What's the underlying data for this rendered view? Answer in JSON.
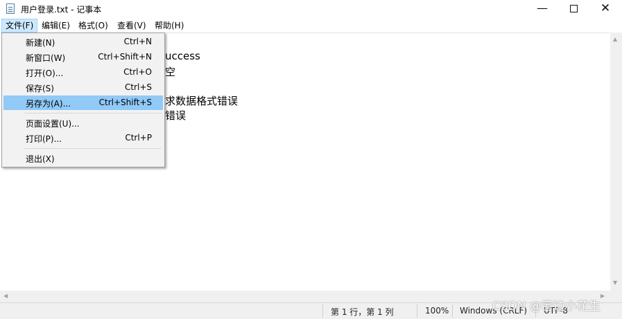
{
  "window": {
    "title": "用户登录.txt - 记事本",
    "minimize": "—",
    "close": "✕"
  },
  "menubar": {
    "file": "文件(F)",
    "edit": "编辑(E)",
    "format": "格式(O)",
    "view": "查看(V)",
    "help": "帮助(H)"
  },
  "file_menu": {
    "items": [
      {
        "label": "新建(N)",
        "shortcut": "Ctrl+N"
      },
      {
        "label": "新窗口(W)",
        "shortcut": "Ctrl+Shift+N"
      },
      {
        "label": "打开(O)...",
        "shortcut": "Ctrl+O"
      },
      {
        "label": "保存(S)",
        "shortcut": "Ctrl+S"
      },
      {
        "label": "另存为(A)...",
        "shortcut": "Ctrl+Shift+S"
      },
      {
        "label": "页面设置(U)...",
        "shortcut": ""
      },
      {
        "label": "打印(P)...",
        "shortcut": "Ctrl+P"
      },
      {
        "label": "退出(X)",
        "shortcut": ""
      }
    ]
  },
  "editor": {
    "lines": [
      "uccess",
      "空",
      "",
      "求数据格式错误",
      "错误"
    ]
  },
  "statusbar": {
    "position": "第 1 行，第 1 列",
    "zoom": "100%",
    "line_ending": "Windows (CRLF)",
    "encoding": "UTF-8"
  },
  "watermark": "CSDN @窗边小花生"
}
